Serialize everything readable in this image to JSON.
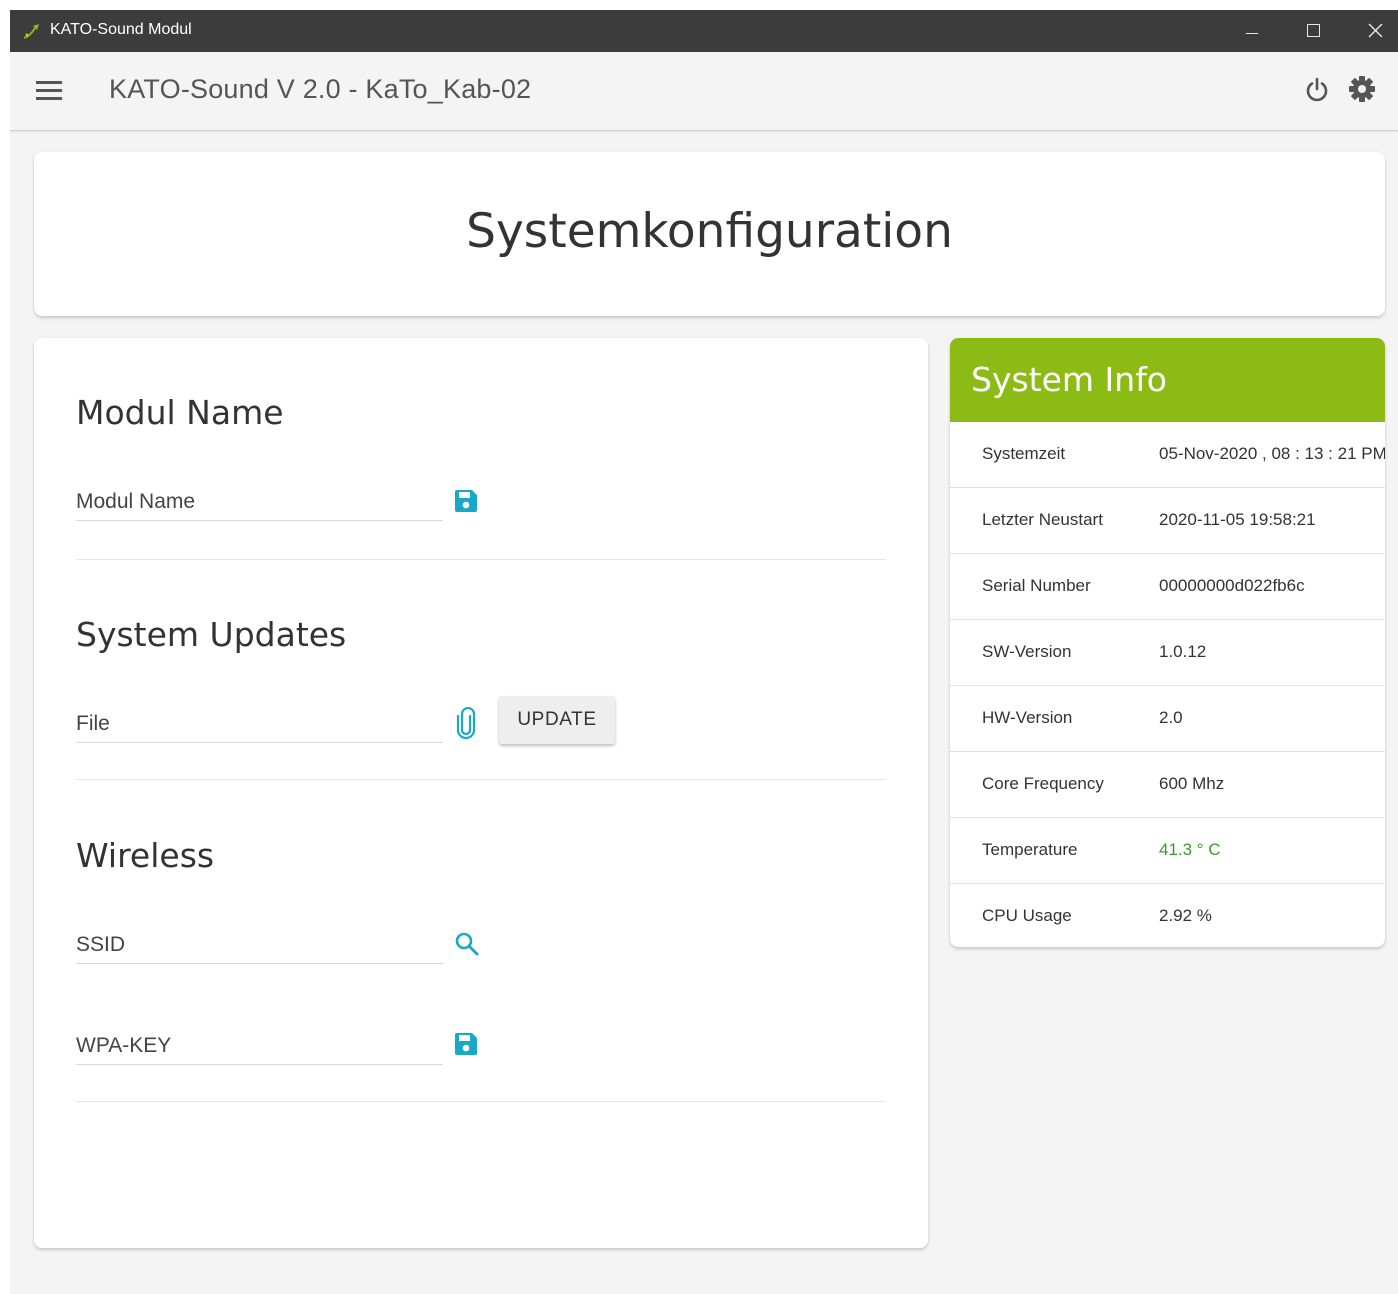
{
  "window": {
    "title": "KATO-Sound Modul",
    "icon": "kato-logo-icon"
  },
  "appbar": {
    "title": "KATO-Sound V 2.0 - KaTo_Kab-02",
    "icons": [
      "menu-icon",
      "power-icon",
      "gear-icon"
    ]
  },
  "page": {
    "title": "Systemkonfiguration"
  },
  "config": {
    "modul_section": {
      "title": "Modul Name",
      "field_label": "Modul Name",
      "icon": "save-icon"
    },
    "updates_section": {
      "title": "System Updates",
      "field_label": "File",
      "icon": "paperclip-icon",
      "button_label": "UPDATE"
    },
    "wireless_section": {
      "title": "Wireless",
      "ssid_label": "SSID",
      "ssid_icon": "search-icon",
      "wpa_label": "WPA-KEY",
      "wpa_icon": "save-icon"
    }
  },
  "system_info": {
    "title": "System Info",
    "rows": [
      {
        "key": "Systemzeit",
        "value": "05-Nov-2020 , 08 : 13 : 21 PM"
      },
      {
        "key": "Letzter Neustart",
        "value": "2020-11-05 19:58:21"
      },
      {
        "key": "Serial Number",
        "value": "00000000d022fb6c"
      },
      {
        "key": "SW-Version",
        "value": "1.0.12"
      },
      {
        "key": "HW-Version",
        "value": "2.0"
      },
      {
        "key": "Core Frequency",
        "value": "600 Mhz"
      },
      {
        "key": "Temperature",
        "value": "41.3 ° C"
      },
      {
        "key": "CPU Usage",
        "value": "2.92 %"
      }
    ]
  },
  "colors": {
    "accent_green": "#8dbb16",
    "icon_cyan": "#1aa8c9",
    "temperature_green": "#3d9a28",
    "titlebar": "#3c3c3c"
  }
}
